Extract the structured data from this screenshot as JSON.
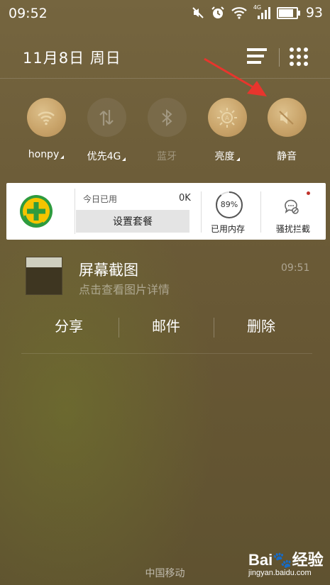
{
  "status_bar": {
    "time": "09:52",
    "network": "4G",
    "battery_percent": "93",
    "battery_level": 0.93,
    "icons": [
      "mute-icon",
      "alarm-icon",
      "wifi-icon",
      "signal-icon",
      "battery-icon"
    ]
  },
  "header": {
    "date": "11月8日  周日",
    "icons": [
      "list-menu-icon",
      "apps-grid-icon"
    ]
  },
  "toggles": [
    {
      "label": "honpy",
      "icon": "wifi-icon",
      "state": "on"
    },
    {
      "label": "优先4G",
      "icon": "mobile-data-icon",
      "state": "off"
    },
    {
      "label": "蓝牙",
      "icon": "bluetooth-icon",
      "state": "off"
    },
    {
      "label": "亮度",
      "icon": "brightness-icon",
      "state": "on"
    },
    {
      "label": "静音",
      "icon": "mute-icon",
      "state": "on"
    }
  ],
  "card": {
    "today_label": "今日已用",
    "today_value": "0K",
    "set_plan": "设置套餐",
    "memory_percent": "89%",
    "memory_value": 0.89,
    "memory_label": "已用内存",
    "block_label": "骚扰拦截"
  },
  "notification": {
    "title": "屏幕截图",
    "time": "09:51",
    "subtitle": "点击查看图片详情",
    "actions": [
      "分享",
      "邮件",
      "删除"
    ]
  },
  "carrier": "中国移动",
  "watermark": {
    "line1": "Bai🐾经验",
    "line2": "jingyan.baidu.com"
  },
  "colors": {
    "accent_wood": "#c9a46a",
    "arrow_red": "#e8352d"
  }
}
